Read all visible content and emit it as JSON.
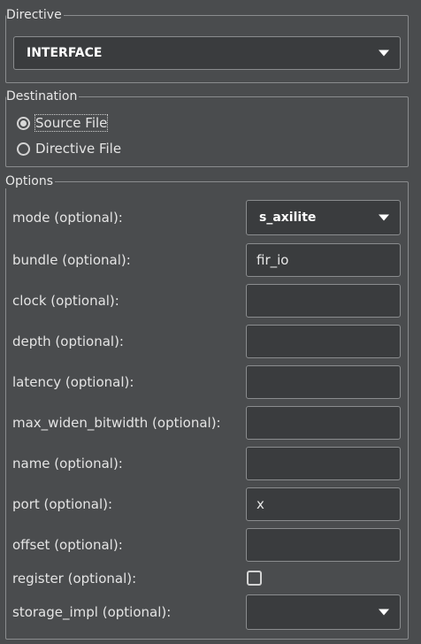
{
  "directive": {
    "title": "Directive",
    "selected": "INTERFACE"
  },
  "destination": {
    "title": "Destination",
    "options": [
      {
        "label": "Source File",
        "checked": true
      },
      {
        "label": "Directive File",
        "checked": false
      }
    ]
  },
  "options": {
    "title": "Options",
    "fields": [
      {
        "label": "mode (optional):",
        "type": "combo",
        "value": "s_axilite"
      },
      {
        "label": "bundle (optional):",
        "type": "text",
        "value": "fir_io"
      },
      {
        "label": "clock (optional):",
        "type": "text",
        "value": ""
      },
      {
        "label": "depth (optional):",
        "type": "text",
        "value": ""
      },
      {
        "label": "latency (optional):",
        "type": "text",
        "value": ""
      },
      {
        "label": "max_widen_bitwidth (optional):",
        "type": "text",
        "value": ""
      },
      {
        "label": "name (optional):",
        "type": "text",
        "value": ""
      },
      {
        "label": "port (optional):",
        "type": "text",
        "value": "x"
      },
      {
        "label": "offset (optional):",
        "type": "text",
        "value": ""
      },
      {
        "label": "register (optional):",
        "type": "checkbox",
        "checked": false
      },
      {
        "label": "storage_impl (optional):",
        "type": "combo",
        "value": ""
      }
    ]
  },
  "icons": {
    "dropdown": "chevron-down-icon",
    "radio": "radio-button-icon"
  },
  "colors": {
    "background": "#4a4c4e",
    "field_background": "#3a3c3e",
    "border": "#8a8c8e",
    "text": "#e4e4e4"
  }
}
